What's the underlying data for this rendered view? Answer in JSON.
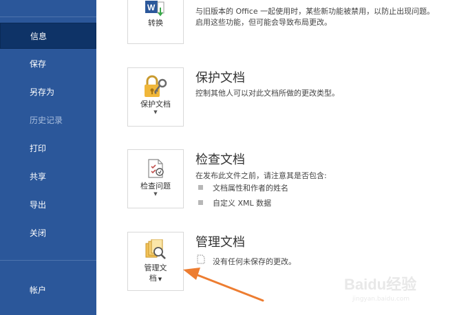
{
  "sidebar": {
    "items": [
      {
        "label": "信息",
        "active": true
      },
      {
        "label": "保存"
      },
      {
        "label": "另存为"
      },
      {
        "label": "历史记录",
        "disabled": true
      },
      {
        "label": "打印"
      },
      {
        "label": "共享"
      },
      {
        "label": "导出"
      },
      {
        "label": "关闭"
      }
    ],
    "account": "帐户"
  },
  "convert": {
    "button_label": "转换",
    "desc_line1": "与旧版本的 Office 一起使用时，某些新功能被禁用，以防止出现问题。",
    "desc_line2": "启用这些功能，但可能会导致布局更改。"
  },
  "protect": {
    "title": "保护文档",
    "button_label": "保护文档",
    "desc": "控制其他人可以对此文档所做的更改类型。"
  },
  "inspect": {
    "title": "检查文档",
    "button_label": "检查问题",
    "desc": "在发布此文件之前，请注意其是否包含:",
    "bullets": [
      "文档属性和作者的姓名",
      "自定义 XML 数据"
    ]
  },
  "manage": {
    "title": "管理文档",
    "button_label_line1": "管理文",
    "button_label_line2": "档",
    "desc": "没有任何未保存的更改。"
  },
  "watermark": {
    "brand": "Baidu经验",
    "url": "jingyan.baidu.com"
  },
  "colors": {
    "sidebar": "#2b579a",
    "sidebar_active": "#0e3367",
    "arrow": "#ed7d31"
  }
}
